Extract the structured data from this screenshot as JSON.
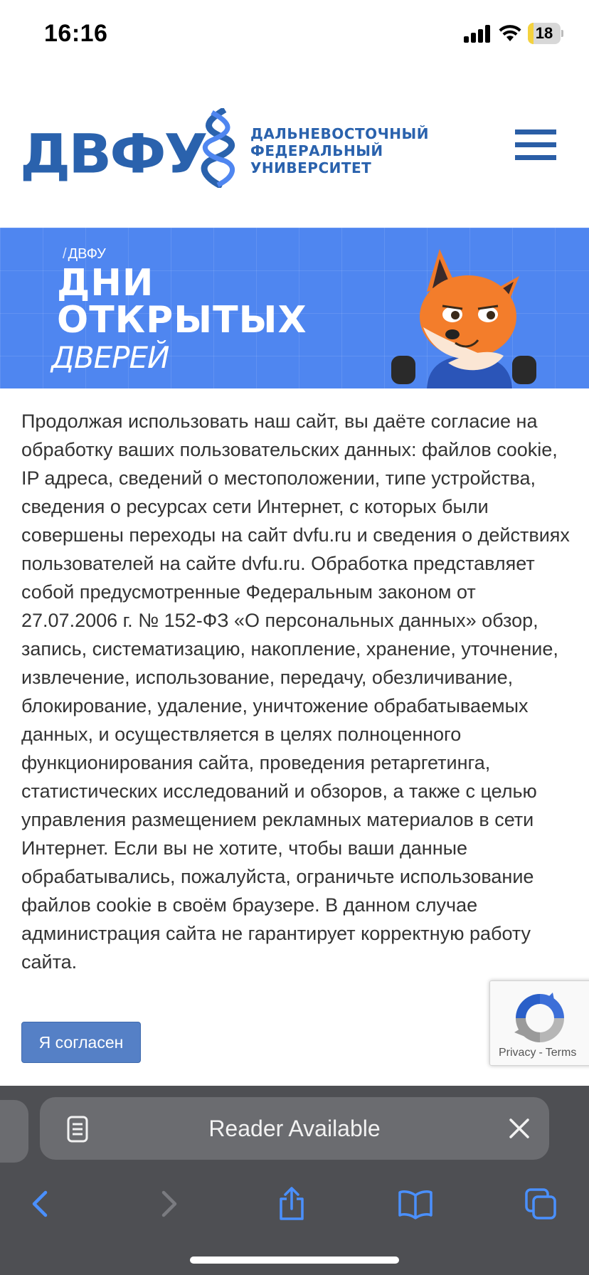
{
  "status_bar": {
    "time": "16:16",
    "battery": "18",
    "battery_level_percent": 18
  },
  "site": {
    "logo_word": "ДВФУ",
    "logo_lines": [
      "ДАЛЬНЕВОСТОЧНЫЙ",
      "ФЕДЕРАЛЬНЫЙ",
      "УНИВЕРСИТЕТ"
    ],
    "brand_color": "#2a62ad",
    "menu_icon": "hamburger-menu-icon"
  },
  "banner": {
    "brand": "ДВФУ",
    "title_line1": "ДНИ",
    "title_line2": "ОТКРЫТЫХ",
    "subtitle": "ДВЕРЕЙ",
    "background_color": "#4f86f0",
    "illustration": "fox-mascot-illustration"
  },
  "consent": {
    "text": "Продолжая использовать наш сайт, вы даёте согласие на обработку ваших пользовательских данных: файлов cookie, IP адреса, сведений о местоположении, типе устройства, сведения о ресурсах сети Интернет, с которых были совершены переходы на сайт dvfu.ru и сведения о действиях пользователей на сайте dvfu.ru. Обработка представляет собой предусмотренные Федеральным законом от 27.07.2006 г. № 152-ФЗ «О персональных данных» обзор, запись, систематизацию, накопление, хранение, уточнение, извлечение, использование, передачу, обезличивание, блокирование, удаление, уничтожение обрабатываемых данных, и осуществляется в целях полноценного функционирования сайта, проведения ретаргетинга, статистических исследований и обзоров, а также с целью управления размещением рекламных материалов в сети Интернет. Если вы не хотите, чтобы ваши данные обрабатывались, пожалуйста, ограничьте использование файлов cookie в своём браузере. В данном случае администрация сайта не гарантирует корректную работу сайта.",
    "agree_label": "Я согласен",
    "button_color": "#5580c6"
  },
  "recaptcha": {
    "privacy": "Privacy",
    "separator": "-",
    "terms": "Terms"
  },
  "safari": {
    "reader_label": "Reader Available",
    "icons": [
      "reader-icon",
      "close-icon",
      "back-icon",
      "forward-icon",
      "share-icon",
      "bookmarks-icon",
      "tabs-icon"
    ],
    "accent_color": "#4a90ff"
  }
}
